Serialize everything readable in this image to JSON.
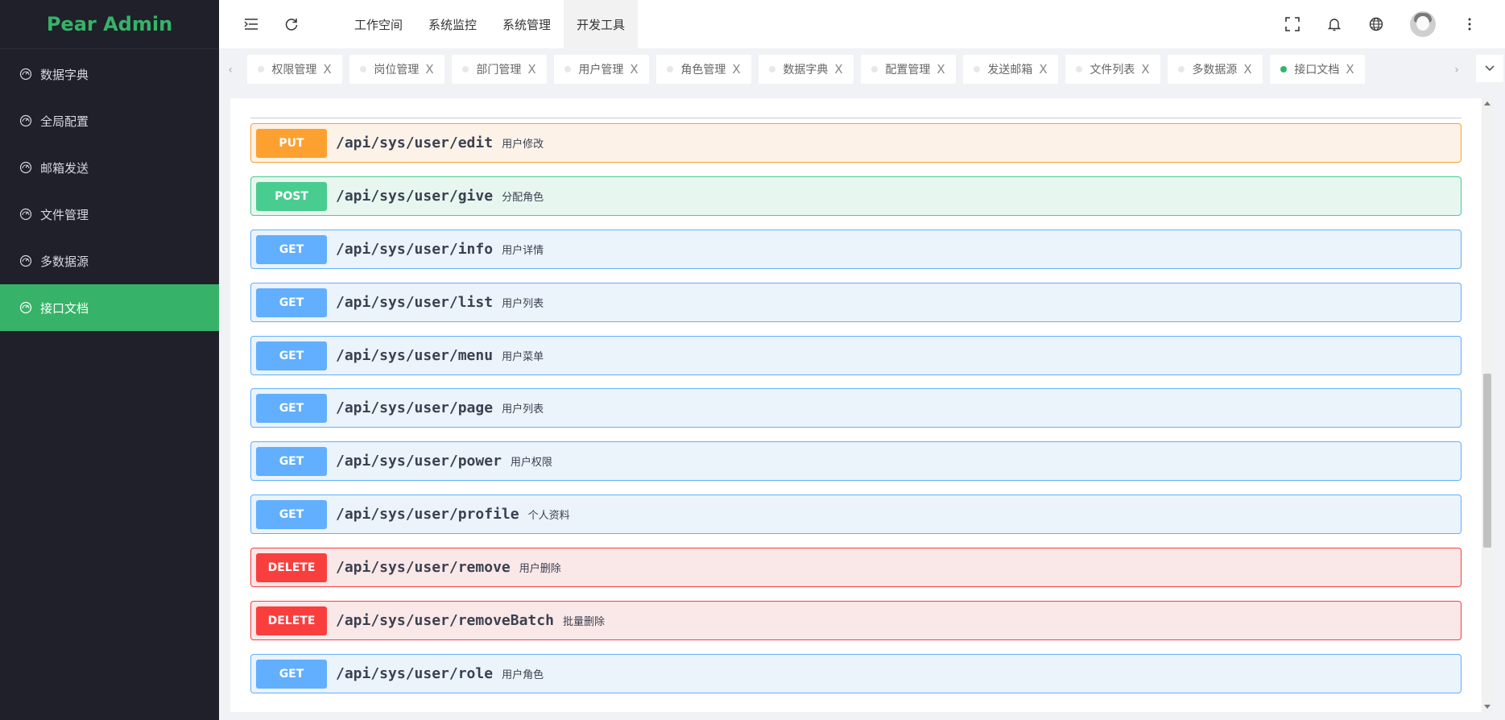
{
  "app": {
    "logo": "Pear Admin"
  },
  "sidebar": {
    "items": [
      {
        "label": "数据字典",
        "active": false
      },
      {
        "label": "全局配置",
        "active": false
      },
      {
        "label": "邮箱发送",
        "active": false
      },
      {
        "label": "文件管理",
        "active": false
      },
      {
        "label": "多数据源",
        "active": false
      },
      {
        "label": "接口文档",
        "active": true
      }
    ]
  },
  "header": {
    "nav": [
      {
        "label": "工作空间",
        "active": false
      },
      {
        "label": "系统监控",
        "active": false
      },
      {
        "label": "系统管理",
        "active": false
      },
      {
        "label": "开发工具",
        "active": true
      }
    ]
  },
  "tabs": [
    {
      "label": "权限管理",
      "close": "X",
      "active": false
    },
    {
      "label": "岗位管理",
      "close": "X",
      "active": false
    },
    {
      "label": "部门管理",
      "close": "X",
      "active": false
    },
    {
      "label": "用户管理",
      "close": "X",
      "active": false
    },
    {
      "label": "角色管理",
      "close": "X",
      "active": false
    },
    {
      "label": "数据字典",
      "close": "X",
      "active": false
    },
    {
      "label": "配置管理",
      "close": "X",
      "active": false
    },
    {
      "label": "发送邮箱",
      "close": "X",
      "active": false
    },
    {
      "label": "文件列表",
      "close": "X",
      "active": false
    },
    {
      "label": "多数据源",
      "close": "X",
      "active": false
    },
    {
      "label": "接口文档",
      "close": "X",
      "active": true
    }
  ],
  "colors": {
    "brand": "#36b368",
    "put": "#fca130",
    "post": "#49cc90",
    "get": "#61affe",
    "delete": "#f93e3e"
  },
  "operations": [
    {
      "method": "PUT",
      "path": "/api/sys/user/edit",
      "desc": "用户修改"
    },
    {
      "method": "POST",
      "path": "/api/sys/user/give",
      "desc": "分配角色"
    },
    {
      "method": "GET",
      "path": "/api/sys/user/info",
      "desc": "用户详情"
    },
    {
      "method": "GET",
      "path": "/api/sys/user/list",
      "desc": "用户列表"
    },
    {
      "method": "GET",
      "path": "/api/sys/user/menu",
      "desc": "用户菜单"
    },
    {
      "method": "GET",
      "path": "/api/sys/user/page",
      "desc": "用户列表"
    },
    {
      "method": "GET",
      "path": "/api/sys/user/power",
      "desc": "用户权限"
    },
    {
      "method": "GET",
      "path": "/api/sys/user/profile",
      "desc": "个人资料"
    },
    {
      "method": "DELETE",
      "path": "/api/sys/user/remove",
      "desc": "用户删除"
    },
    {
      "method": "DELETE",
      "path": "/api/sys/user/removeBatch",
      "desc": "批量删除"
    },
    {
      "method": "GET",
      "path": "/api/sys/user/role",
      "desc": "用户角色"
    }
  ]
}
